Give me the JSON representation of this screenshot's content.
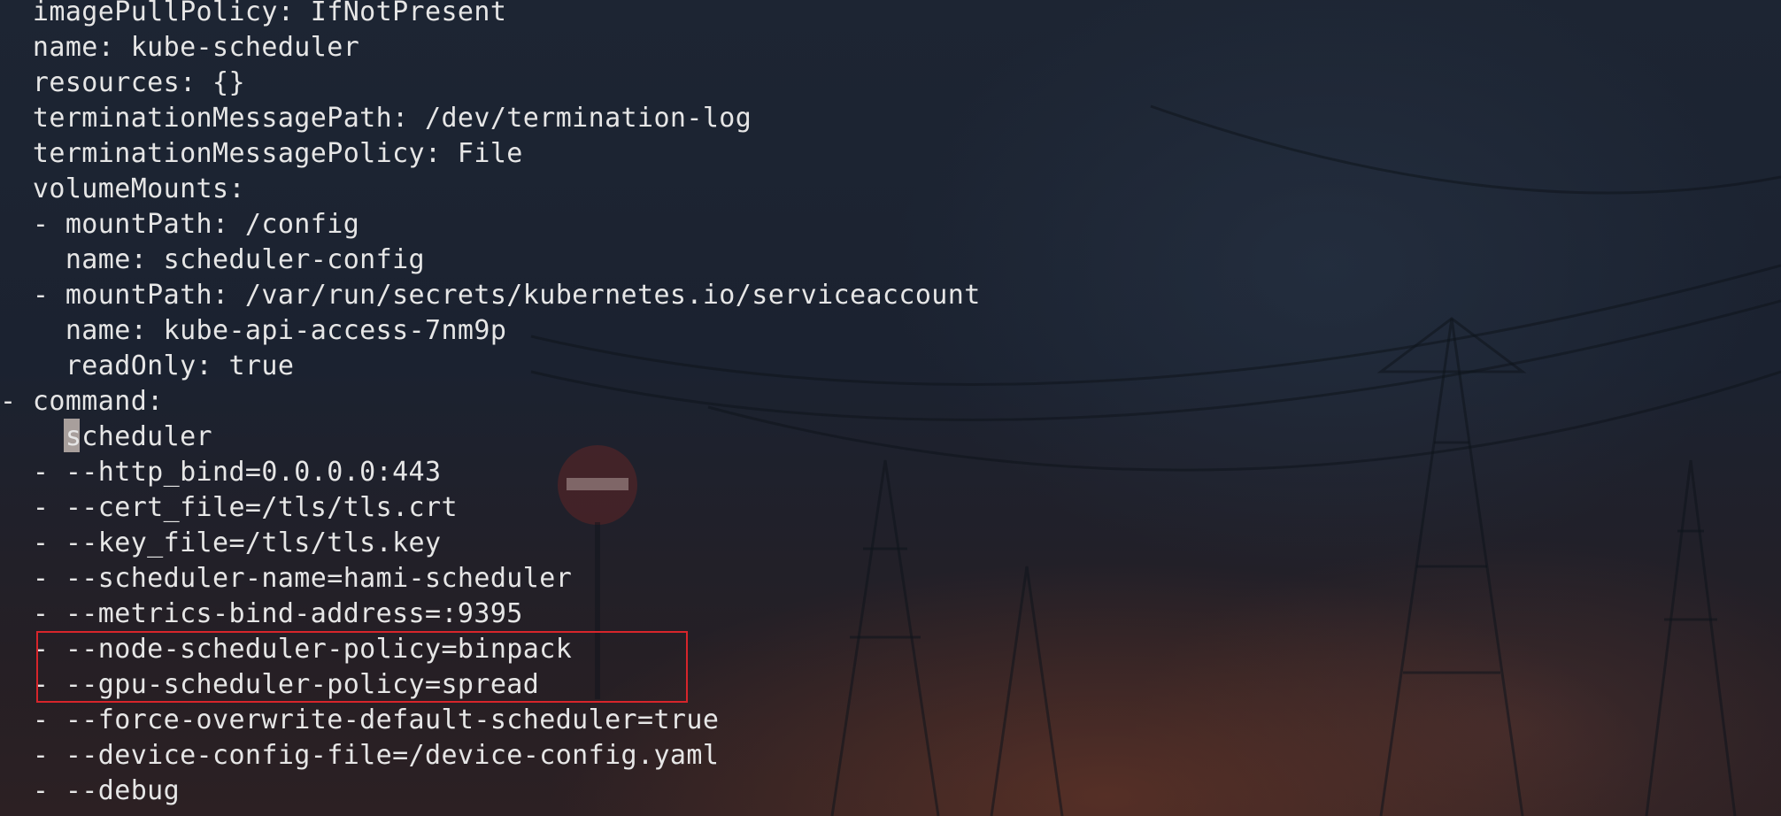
{
  "terminal": {
    "lines": [
      "  imagePullPolicy: IfNotPresent",
      "  name: kube-scheduler",
      "  resources: {}",
      "  terminationMessagePath: /dev/termination-log",
      "  terminationMessagePolicy: File",
      "  volumeMounts:",
      "  - mountPath: /config",
      "    name: scheduler-config",
      "  - mountPath: /var/run/secrets/kubernetes.io/serviceaccount",
      "    name: kube-api-access-7nm9p",
      "    readOnly: true",
      "- command:",
      "    scheduler",
      "  - --http_bind=0.0.0.0:443",
      "  - --cert_file=/tls/tls.crt",
      "  - --key_file=/tls/tls.key",
      "  - --scheduler-name=hami-scheduler",
      "  - --metrics-bind-address=:9395",
      "  - --node-scheduler-policy=binpack",
      "  - --gpu-scheduler-policy=spread",
      "  - --force-overwrite-default-scheduler=true",
      "  - --device-config-file=/device-config.yaml",
      "  - --debug"
    ],
    "text_color": "#e6e6e6",
    "cursor_color": "#a89f9c",
    "highlight_color": "#d7252b"
  }
}
